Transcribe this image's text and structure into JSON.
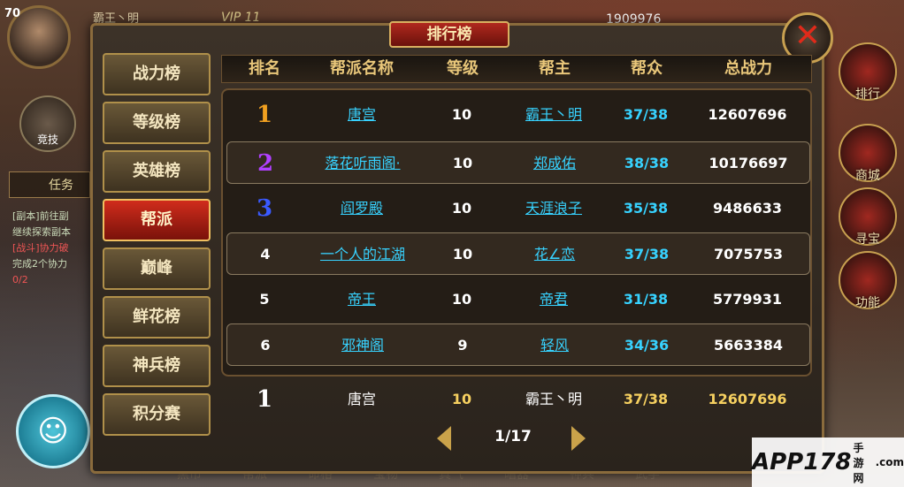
{
  "hud": {
    "level": "70",
    "player_name": "霸王丶明",
    "vip": "VIP 11",
    "gold": "1909976",
    "compete_label": "竞技",
    "task_label": "任务",
    "task_line1": "[副本]前往副",
    "task_line2": "继续探索副本",
    "task_line3": "[战斗]协力破",
    "task_line4": "完成2个协力",
    "task_line5": "0/2",
    "right_icons": [
      "排行",
      "商城",
      "寻宝",
      "功能"
    ],
    "bottom_menu": [
      "黑市",
      "帮派",
      "命格",
      "宝物",
      "真气",
      "暗器",
      "神兵",
      "武学",
      "宝石"
    ]
  },
  "panel": {
    "title": "排行榜",
    "close_symbol": "✕"
  },
  "tabs": [
    {
      "label": "战力榜",
      "active": false
    },
    {
      "label": "等级榜",
      "active": false
    },
    {
      "label": "英雄榜",
      "active": false
    },
    {
      "label": "帮派",
      "active": true
    },
    {
      "label": "巅峰",
      "active": false
    },
    {
      "label": "鲜花榜",
      "active": false
    },
    {
      "label": "神兵榜",
      "active": false
    },
    {
      "label": "积分赛",
      "active": false
    }
  ],
  "table": {
    "headers": [
      "排名",
      "帮派名称",
      "等级",
      "帮主",
      "帮众",
      "总战力"
    ],
    "rows": [
      {
        "rank": "1",
        "guild": "唐宫",
        "level": "10",
        "leader": "霸王丶明",
        "members": "37/38",
        "power": "12607696"
      },
      {
        "rank": "2",
        "guild": "落花听雨阁·",
        "level": "10",
        "leader": "郑成佑",
        "members": "38/38",
        "power": "10176697"
      },
      {
        "rank": "3",
        "guild": "阎罗殿",
        "level": "10",
        "leader": "天涯浪子",
        "members": "35/38",
        "power": "9486633"
      },
      {
        "rank": "4",
        "guild": "一个人的江湖",
        "level": "10",
        "leader": "花∠恋",
        "members": "37/38",
        "power": "7075753"
      },
      {
        "rank": "5",
        "guild": "帝王",
        "level": "10",
        "leader": "帝君",
        "members": "31/38",
        "power": "5779931"
      },
      {
        "rank": "6",
        "guild": "邪神阁",
        "level": "9",
        "leader": "轻风",
        "members": "34/36",
        "power": "5663384"
      }
    ],
    "my_row": {
      "rank": "1",
      "guild": "唐宫",
      "level": "10",
      "leader": "霸王丶明",
      "members": "37/38",
      "power": "12607696"
    }
  },
  "pager": {
    "text": "1/17"
  },
  "watermark": {
    "main": "APP178",
    "sub": "手游网",
    "domain": ".com"
  }
}
